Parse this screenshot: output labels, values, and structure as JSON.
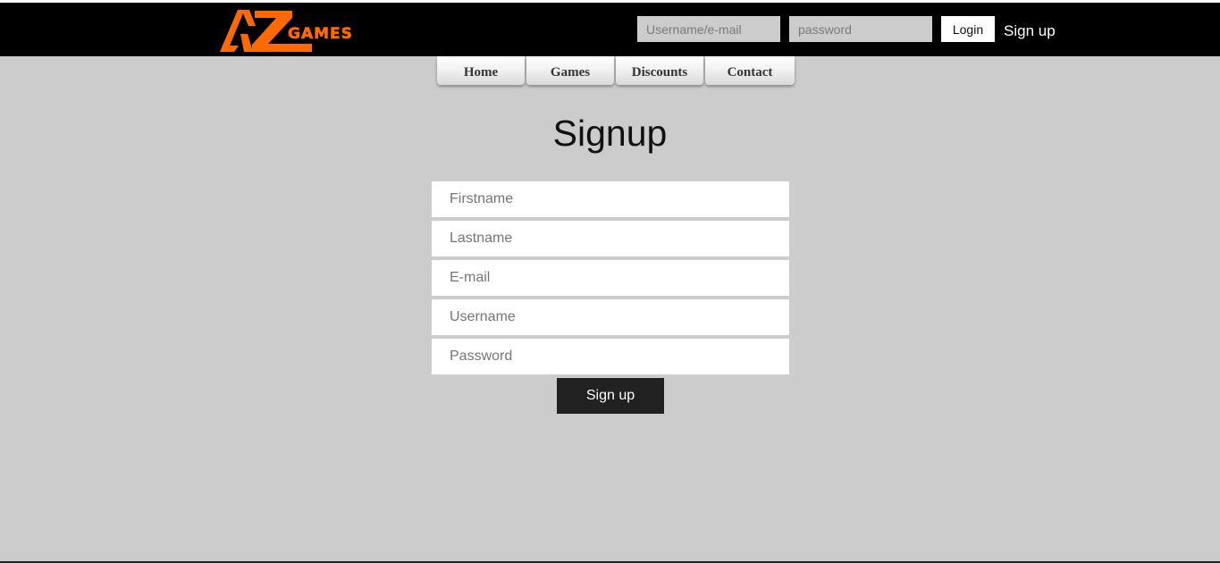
{
  "header": {
    "logo": {
      "letters": "AZ",
      "word": "GAMES",
      "color": "#ff6a00"
    },
    "login": {
      "username_placeholder": "Username/e-mail",
      "password_placeholder": "password",
      "login_label": "Login",
      "signup_link": "Sign up"
    }
  },
  "nav": {
    "items": [
      {
        "label": "Home"
      },
      {
        "label": "Games"
      },
      {
        "label": "Discounts"
      },
      {
        "label": "Contact"
      }
    ]
  },
  "main": {
    "title": "Signup",
    "fields": {
      "firstname": "Firstname",
      "lastname": "Lastname",
      "email": "E-mail",
      "username": "Username",
      "password": "Password"
    },
    "submit_label": "Sign up"
  },
  "colors": {
    "header_bg": "#000000",
    "page_bg": "#cccccc",
    "accent": "#ff6a00",
    "button_dark": "#212121"
  }
}
